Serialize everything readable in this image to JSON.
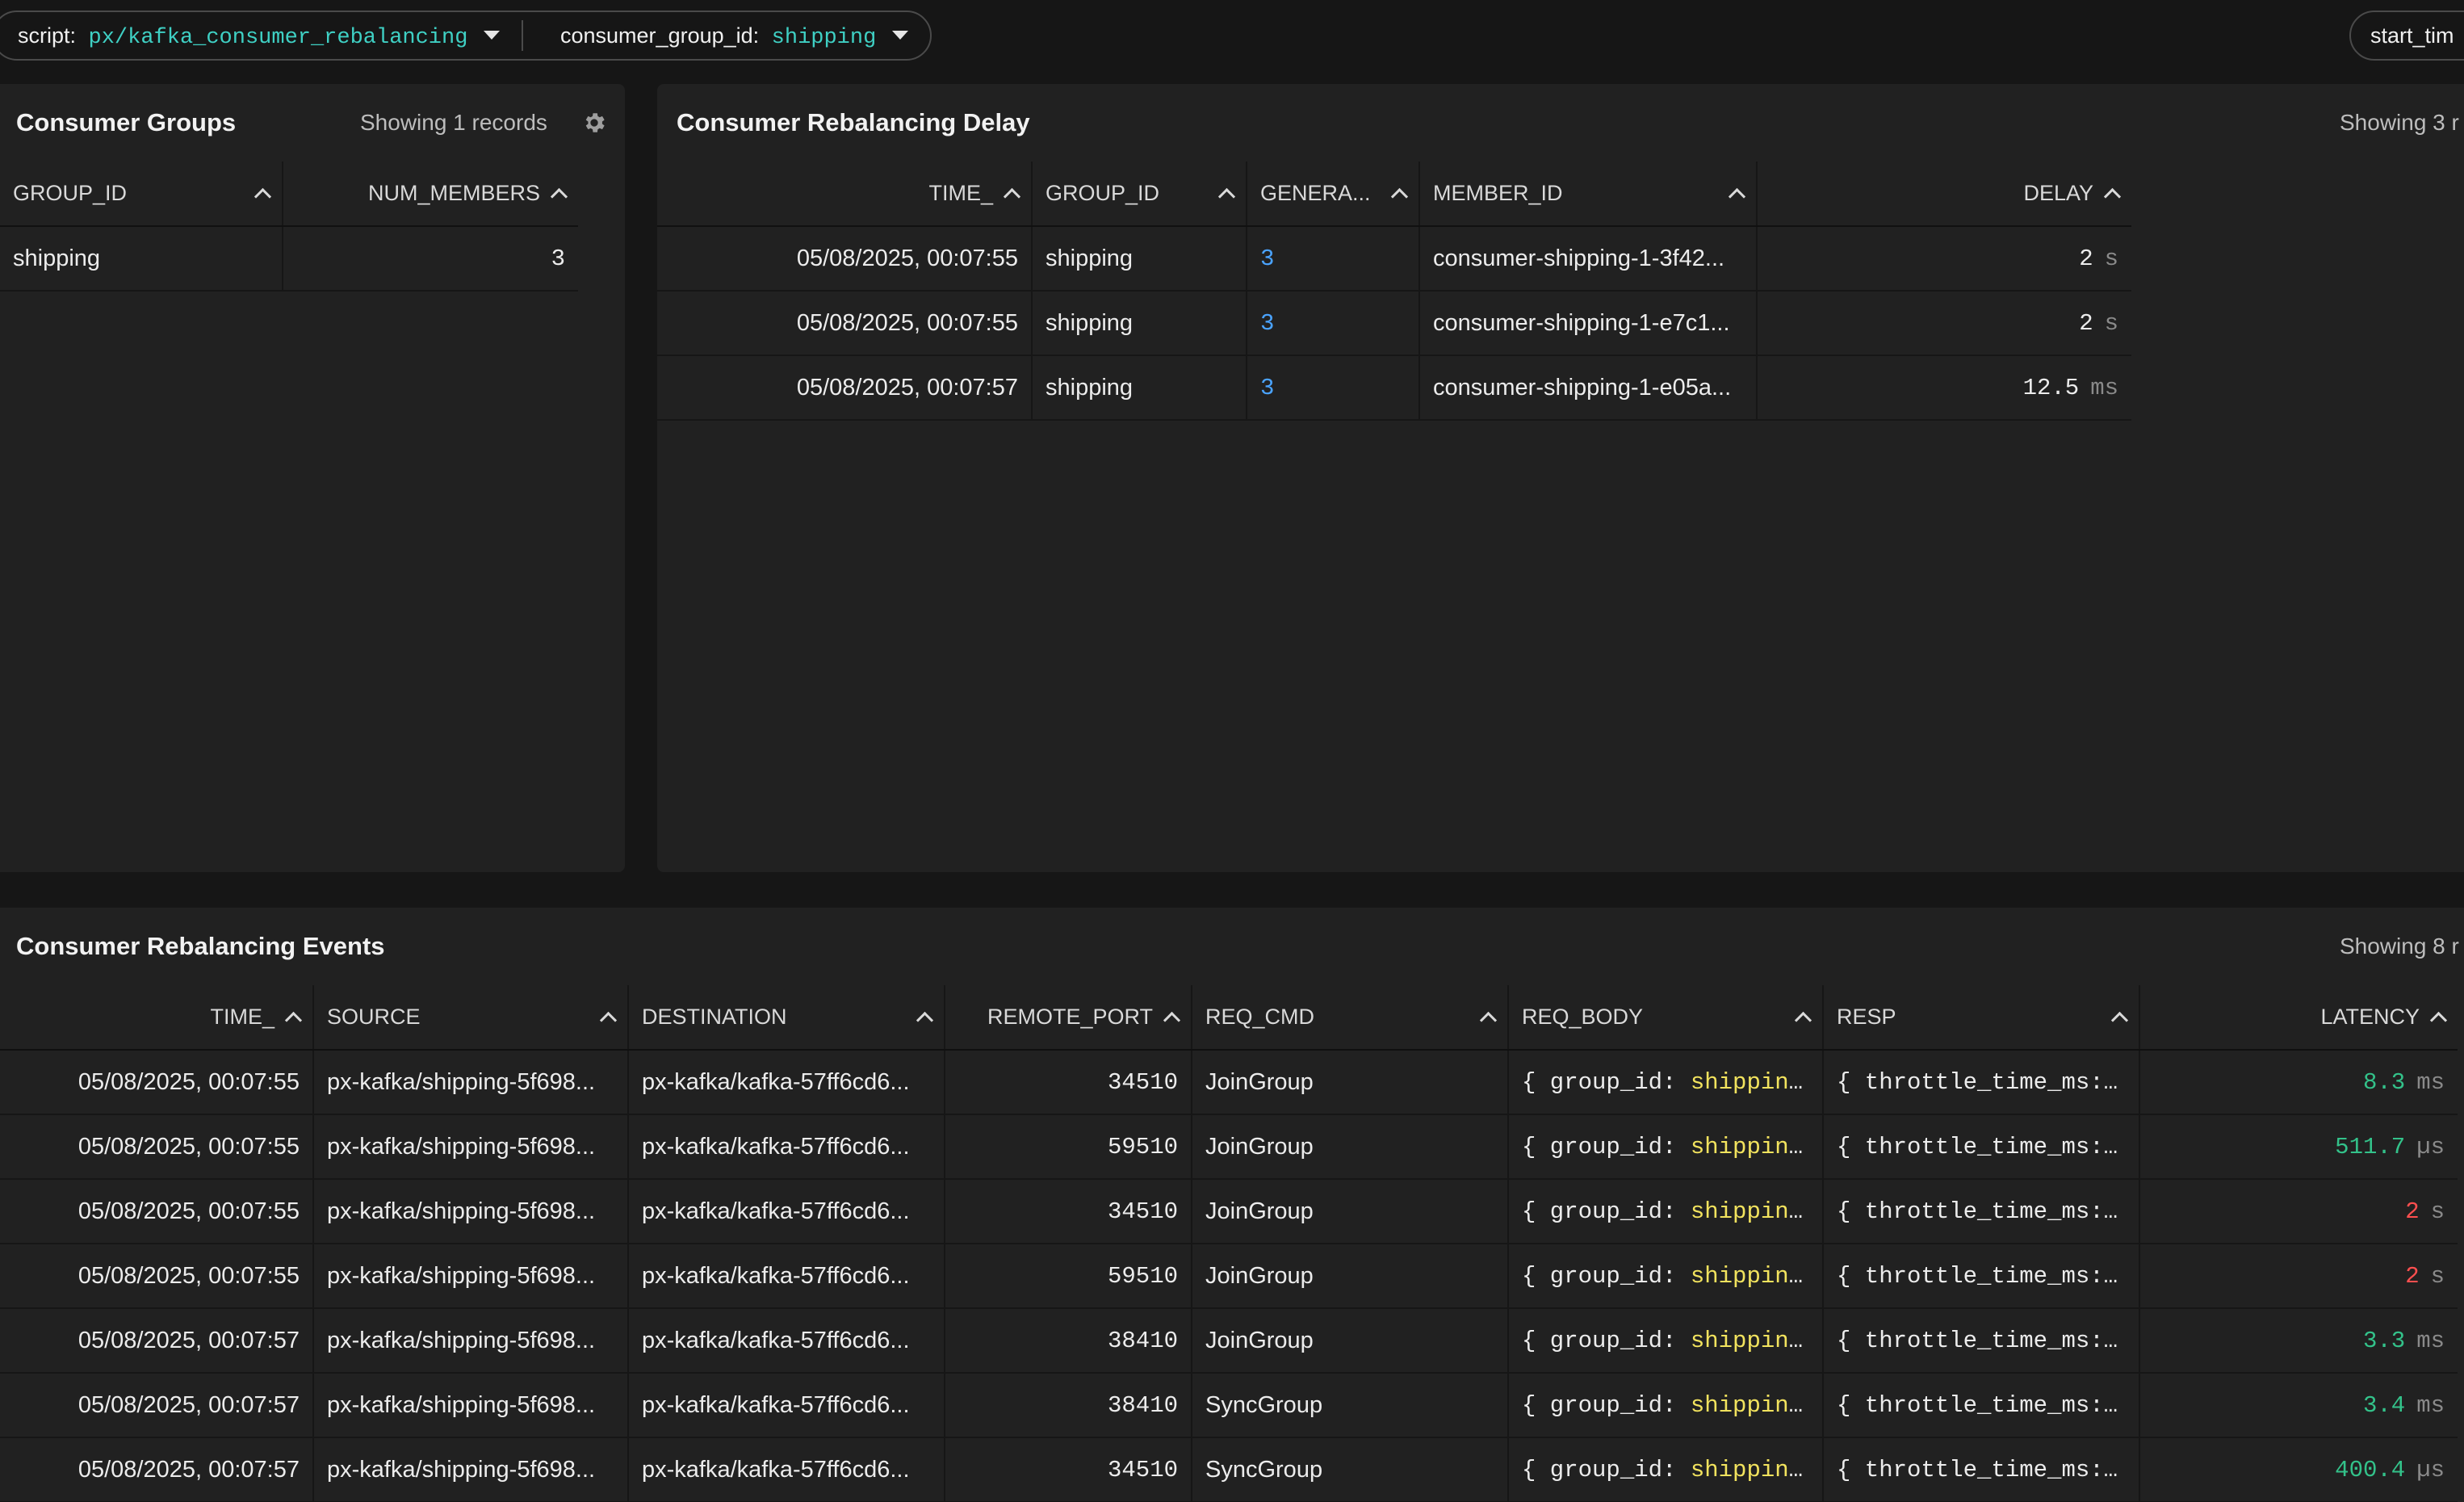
{
  "topbar": {
    "script_label": "script:",
    "script_value": "px/kafka_consumer_rebalancing",
    "group_label": "consumer_group_id:",
    "group_value": "shipping",
    "start_label": "start_tim"
  },
  "consumer_groups": {
    "title": "Consumer Groups",
    "showing": "Showing 1 records",
    "columns": [
      "GROUP_ID",
      "NUM_MEMBERS"
    ],
    "rows": [
      {
        "group_id": "shipping",
        "num_members": "3"
      }
    ]
  },
  "rebalancing_delay": {
    "title": "Consumer Rebalancing Delay",
    "showing": "Showing 3 r",
    "columns": [
      "TIME_",
      "GROUP_ID",
      "GENERA...",
      "MEMBER_ID",
      "DELAY"
    ],
    "rows": [
      {
        "time": "05/08/2025, 00:07:55",
        "group_id": "shipping",
        "generation": "3",
        "member_id": "consumer-shipping-1-3f42...",
        "delay": "2",
        "unit": "s"
      },
      {
        "time": "05/08/2025, 00:07:55",
        "group_id": "shipping",
        "generation": "3",
        "member_id": "consumer-shipping-1-e7c1...",
        "delay": "2",
        "unit": "s"
      },
      {
        "time": "05/08/2025, 00:07:57",
        "group_id": "shipping",
        "generation": "3",
        "member_id": "consumer-shipping-1-e05a...",
        "delay": "12.5",
        "unit": "ms"
      }
    ]
  },
  "rebalancing_events": {
    "title": "Consumer Rebalancing Events",
    "showing": "Showing 8 r",
    "columns": [
      "TIME_",
      "SOURCE",
      "DESTINATION",
      "REMOTE_PORT",
      "REQ_CMD",
      "REQ_BODY",
      "RESP",
      "LATENCY"
    ],
    "req_body_key": "{ group_id:",
    "req_body_val": "shippin...",
    "resp_text": "{ throttle_time_ms:...",
    "rows": [
      {
        "time": "05/08/2025, 00:07:55",
        "source": "px-kafka/shipping-5f698...",
        "destination": "px-kafka/kafka-57ff6cd6...",
        "port": "34510",
        "cmd": "JoinGroup",
        "latency": "8.3",
        "unit": "ms",
        "status": "green"
      },
      {
        "time": "05/08/2025, 00:07:55",
        "source": "px-kafka/shipping-5f698...",
        "destination": "px-kafka/kafka-57ff6cd6...",
        "port": "59510",
        "cmd": "JoinGroup",
        "latency": "511.7",
        "unit": "µs",
        "status": "green"
      },
      {
        "time": "05/08/2025, 00:07:55",
        "source": "px-kafka/shipping-5f698...",
        "destination": "px-kafka/kafka-57ff6cd6...",
        "port": "34510",
        "cmd": "JoinGroup",
        "latency": "2",
        "unit": "s",
        "status": "red"
      },
      {
        "time": "05/08/2025, 00:07:55",
        "source": "px-kafka/shipping-5f698...",
        "destination": "px-kafka/kafka-57ff6cd6...",
        "port": "59510",
        "cmd": "JoinGroup",
        "latency": "2",
        "unit": "s",
        "status": "red"
      },
      {
        "time": "05/08/2025, 00:07:57",
        "source": "px-kafka/shipping-5f698...",
        "destination": "px-kafka/kafka-57ff6cd6...",
        "port": "38410",
        "cmd": "JoinGroup",
        "latency": "3.3",
        "unit": "ms",
        "status": "green"
      },
      {
        "time": "05/08/2025, 00:07:57",
        "source": "px-kafka/shipping-5f698...",
        "destination": "px-kafka/kafka-57ff6cd6...",
        "port": "38410",
        "cmd": "SyncGroup",
        "latency": "3.4",
        "unit": "ms",
        "status": "green"
      },
      {
        "time": "05/08/2025, 00:07:57",
        "source": "px-kafka/shipping-5f698...",
        "destination": "px-kafka/kafka-57ff6cd6...",
        "port": "34510",
        "cmd": "SyncGroup",
        "latency": "400.4",
        "unit": "µs",
        "status": "green"
      }
    ]
  },
  "colors": {
    "accent_teal": "#3fd0c4",
    "link_blue": "#4aa3ff",
    "latency_green": "#33c28a",
    "latency_red": "#ff4f4f",
    "json_value_yellow": "#f2e35e"
  },
  "icons": {
    "settings": "gear-icon",
    "dropdown": "caret-down-icon",
    "sort": "sort-asc-icon"
  }
}
